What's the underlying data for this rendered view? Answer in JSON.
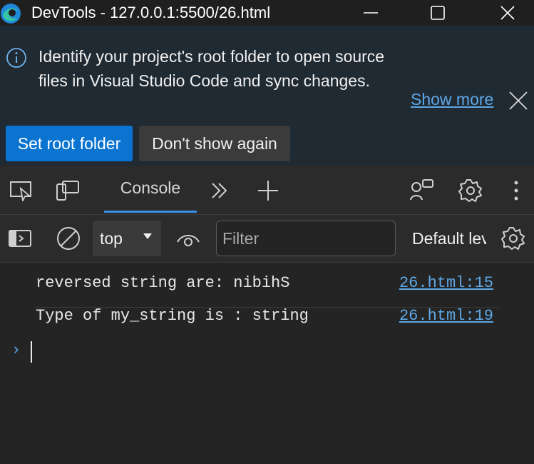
{
  "window": {
    "title": "DevTools - 127.0.0.1:5500/26.html",
    "controls": [
      "minimize",
      "maximize",
      "close"
    ]
  },
  "infobar": {
    "message": "Identify your project's root folder to open source files in Visual Studio Code and sync changes.",
    "show_more": "Show more",
    "primary_button": "Set root folder",
    "secondary_button": "Don't show again"
  },
  "toolbar": {
    "active_tab": "Console",
    "icons": [
      "inspect-element-icon",
      "device-toolbar-icon",
      "more-tabs-icon",
      "add-tab-icon",
      "feedback-icon",
      "settings-icon",
      "menu-icon"
    ]
  },
  "console_toolbar": {
    "context": "top",
    "filter_placeholder": "Filter",
    "levels": "Default levels"
  },
  "console": {
    "messages": [
      {
        "text": "reversed string are: nibihS",
        "source": "26.html:15"
      },
      {
        "text": "Type of my_string is : string",
        "source": "26.html:19"
      }
    ],
    "prompt": "›"
  },
  "colors": {
    "accent": "#0a74d0",
    "link": "#5ea7e6",
    "background": "#242424"
  }
}
